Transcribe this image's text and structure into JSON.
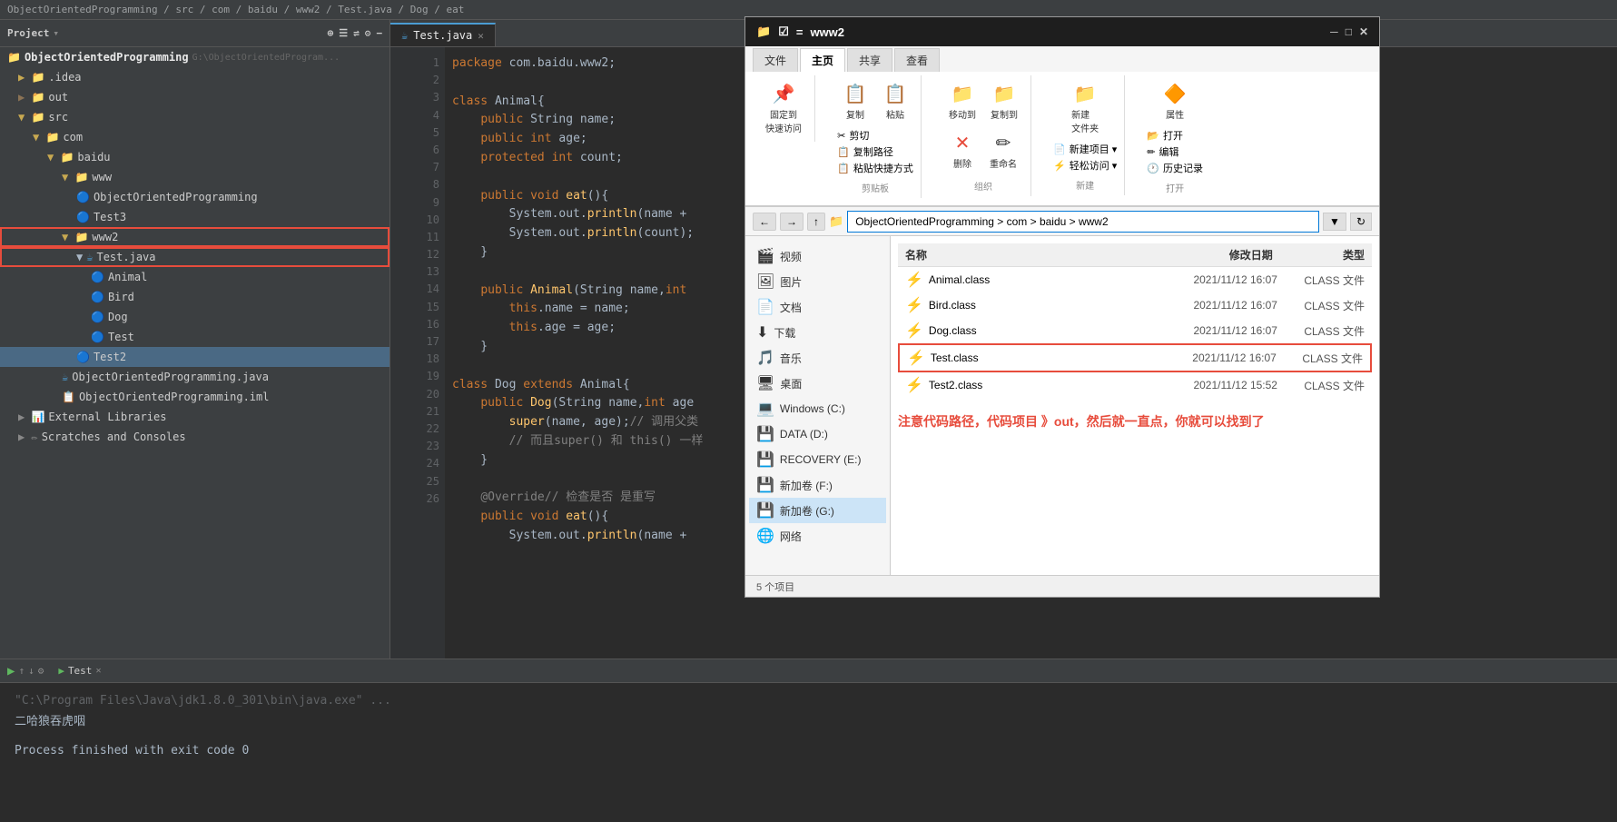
{
  "topbar": {
    "breadcrumb": "ObjectOrientedProgramming / src / com / baidu / www2 / Test.java / Dog / eat"
  },
  "sidebar": {
    "title": "Project",
    "root": "ObjectOrientedProgramming",
    "root_path": "G:\\ObjectOrientedProgram...",
    "items": [
      {
        "id": "idea",
        "label": ".idea",
        "type": "folder",
        "indent": 1
      },
      {
        "id": "out",
        "label": "out",
        "type": "folder",
        "indent": 1
      },
      {
        "id": "src",
        "label": "src",
        "type": "folder",
        "indent": 1,
        "open": true
      },
      {
        "id": "com",
        "label": "com",
        "type": "folder",
        "indent": 2,
        "open": true
      },
      {
        "id": "baidu",
        "label": "baidu",
        "type": "folder",
        "indent": 3,
        "open": true
      },
      {
        "id": "www",
        "label": "www",
        "type": "folder",
        "indent": 4,
        "open": true
      },
      {
        "id": "ObjectOrientedProgramming",
        "label": "ObjectOrientedProgramming",
        "type": "class",
        "indent": 5
      },
      {
        "id": "Test3",
        "label": "Test3",
        "type": "class",
        "indent": 5
      },
      {
        "id": "www2",
        "label": "www2",
        "type": "folder",
        "indent": 4,
        "open": true,
        "highlighted": true
      },
      {
        "id": "TestJava",
        "label": "Test.java",
        "type": "java",
        "indent": 5,
        "highlighted": true
      },
      {
        "id": "Animal",
        "label": "Animal",
        "type": "class_blue",
        "indent": 6,
        "highlighted": true
      },
      {
        "id": "Bird",
        "label": "Bird",
        "type": "class_blue",
        "indent": 6,
        "highlighted": true
      },
      {
        "id": "Dog",
        "label": "Dog",
        "type": "class_blue",
        "indent": 6,
        "highlighted": true
      },
      {
        "id": "Test",
        "label": "Test",
        "type": "class_blue",
        "indent": 6,
        "highlighted": true
      },
      {
        "id": "Test2",
        "label": "Test2",
        "type": "class_blue",
        "indent": 5,
        "selected": true
      },
      {
        "id": "OOPjava",
        "label": "ObjectOrientedProgramming.java",
        "type": "java",
        "indent": 4
      },
      {
        "id": "OOPiml",
        "label": "ObjectOrientedProgramming.iml",
        "type": "file",
        "indent": 4
      },
      {
        "id": "ExternalLibraries",
        "label": "External Libraries",
        "type": "lib",
        "indent": 1
      },
      {
        "id": "ScratchesAndConsoles",
        "label": "Scratches and Consoles",
        "type": "lib",
        "indent": 1
      }
    ]
  },
  "editor": {
    "tab_label": "Test.java",
    "lines": [
      {
        "n": 1,
        "code": "  package com.baidu.www2;"
      },
      {
        "n": 2,
        "code": ""
      },
      {
        "n": 3,
        "code": "  class Animal{"
      },
      {
        "n": 4,
        "code": "      public String name;"
      },
      {
        "n": 5,
        "code": "      public int age;"
      },
      {
        "n": 6,
        "code": "      protected int count;"
      },
      {
        "n": 7,
        "code": ""
      },
      {
        "n": 8,
        "code": "      public void eat(){"
      },
      {
        "n": 9,
        "code": "          System.out.println(name +"
      },
      {
        "n": 10,
        "code": "          System.out.println(count);"
      },
      {
        "n": 11,
        "code": "      }"
      },
      {
        "n": 12,
        "code": ""
      },
      {
        "n": 13,
        "code": "      public Animal(String name,int"
      },
      {
        "n": 14,
        "code": "          this.name = name;"
      },
      {
        "n": 15,
        "code": "          this.age = age;"
      },
      {
        "n": 16,
        "code": "      }"
      },
      {
        "n": 17,
        "code": ""
      },
      {
        "n": 18,
        "code": "  class Dog extends Animal{"
      },
      {
        "n": 19,
        "code": "      public Dog(String name,int age"
      },
      {
        "n": 20,
        "code": "          super(name, age);// 调用父类"
      },
      {
        "n": 21,
        "code": "          // 而且super() 和 this() 一样"
      },
      {
        "n": 22,
        "code": "      }"
      },
      {
        "n": 23,
        "code": ""
      },
      {
        "n": 24,
        "code": "      @Override// 检查是否 是重写"
      },
      {
        "n": 25,
        "code": "      public void eat(){"
      },
      {
        "n": 26,
        "code": "          System.out.println(name +"
      }
    ]
  },
  "run_panel": {
    "tab_label": "Test",
    "cmd_line": "\"C:\\Program Files\\Java\\jdk1.8.0_301\\bin\\java.exe\" ...",
    "output": "二哈狼吞虎咽",
    "exit": "Process finished with exit code 0"
  },
  "file_explorer": {
    "title": "www2",
    "ribbon_tabs": [
      "文件",
      "主页",
      "共享",
      "查看"
    ],
    "active_tab": "主页",
    "address": "ObjectOrientedProgramming > com > baidu > www2",
    "nav_items": [
      {
        "label": "视频",
        "icon": "🎬"
      },
      {
        "label": "图片",
        "icon": "🖼"
      },
      {
        "label": "文档",
        "icon": "📄"
      },
      {
        "label": "下载",
        "icon": "⬇"
      },
      {
        "label": "音乐",
        "icon": "🎵"
      },
      {
        "label": "桌面",
        "icon": "🖥"
      },
      {
        "label": "Windows (C:)",
        "icon": "💻"
      },
      {
        "label": "DATA (D:)",
        "icon": "💾"
      },
      {
        "label": "RECOVERY (E:)",
        "icon": "💾"
      },
      {
        "label": "新加卷 (F:)",
        "icon": "💾"
      },
      {
        "label": "新加卷 (G:)",
        "icon": "💾",
        "selected": true
      },
      {
        "label": "网络",
        "icon": "🌐"
      }
    ],
    "files": [
      {
        "name": "Animal.class",
        "date": "2021/11/12 16:07",
        "type": "CLASS 文件"
      },
      {
        "name": "Bird.class",
        "date": "2021/11/12 16:07",
        "type": "CLASS 文件"
      },
      {
        "name": "Dog.class",
        "date": "2021/11/12 16:07",
        "type": "CLASS 文件"
      },
      {
        "name": "Test.class",
        "date": "2021/11/12 16:07",
        "type": "CLASS 文件",
        "highlighted": true
      },
      {
        "name": "Test2.class",
        "date": "2021/11/12 15:52",
        "type": "CLASS 文件"
      }
    ],
    "columns": [
      "名称",
      "修改日期",
      "类型"
    ],
    "status": "5 个项目",
    "annotation": "注意代码路径，代码项目 》out，然后就一直点，你就可以找到了",
    "ribbon_actions": {
      "pin": "固定到\n快速访问",
      "copy": "复制",
      "paste": "粘贴",
      "cut": "✂ 剪切",
      "copy_path": "复制路径",
      "paste_shortcut": "粘贴快捷方式",
      "move": "移动到",
      "copy_to": "复制到",
      "delete": "删除",
      "rename": "重命名",
      "new_folder": "新建\n文件夹",
      "new_item": "新建项目 ▾",
      "easy_access": "轻松访问 ▾",
      "properties": "属性",
      "open": "打开",
      "edit": "编辑",
      "history": "历史记录",
      "clipboard_group": "剪贴板",
      "organize_group": "组织",
      "new_group": "新建",
      "open_group": "打开"
    }
  }
}
